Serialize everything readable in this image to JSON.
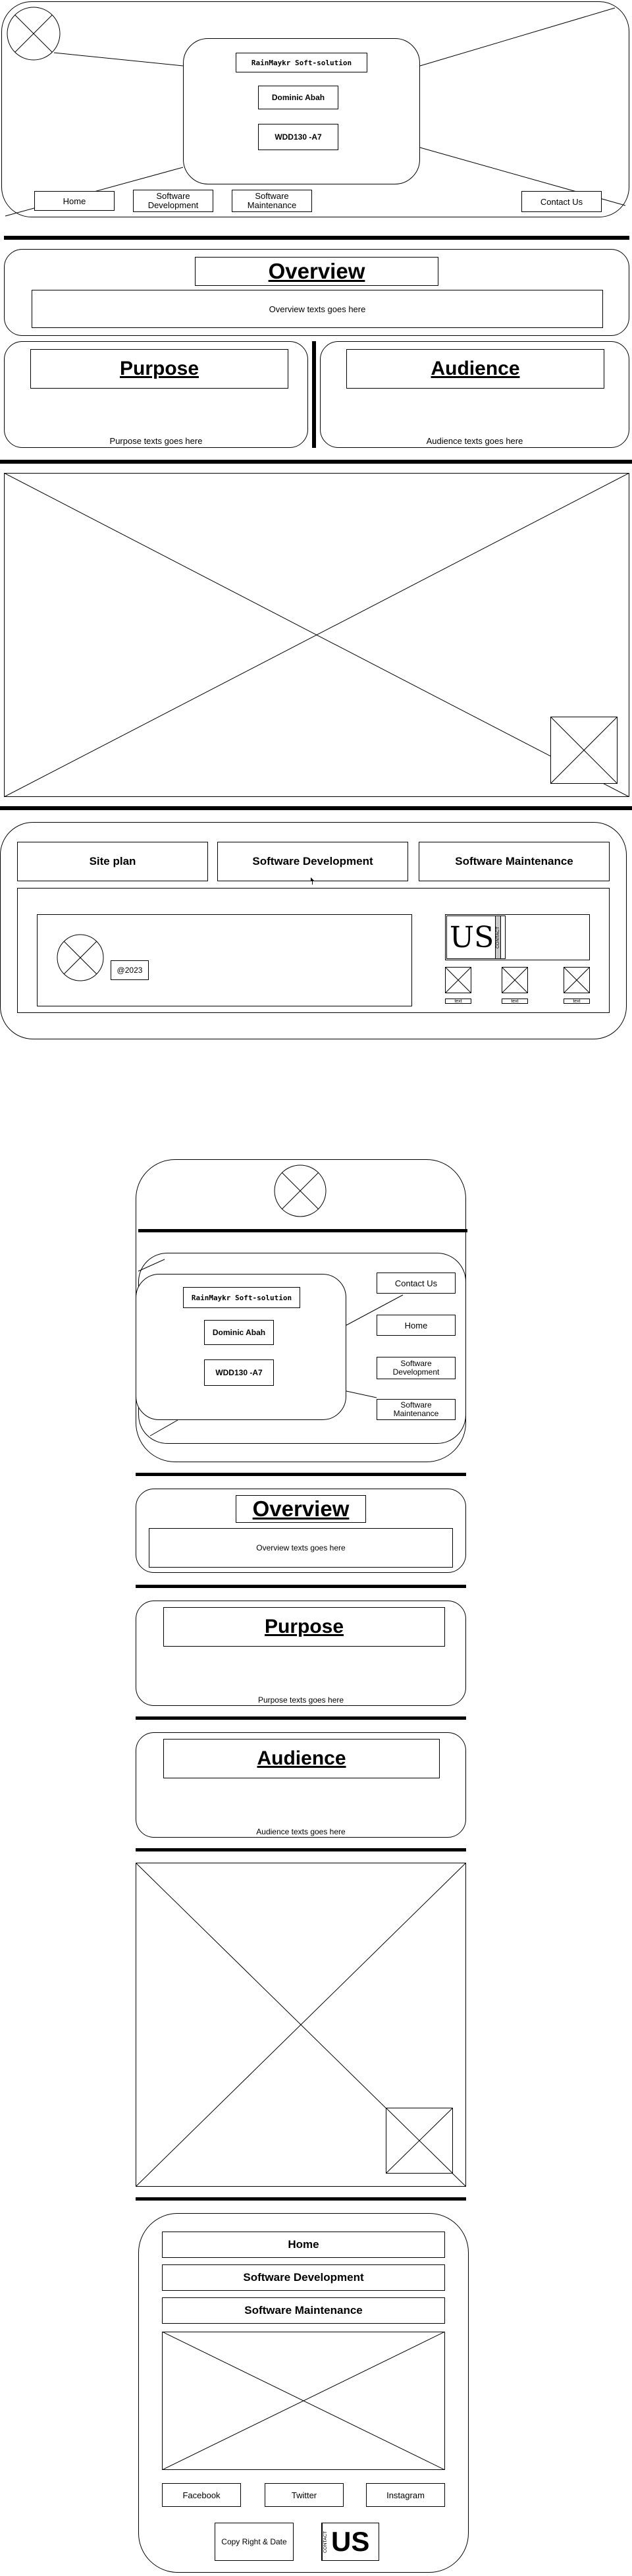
{
  "brand": {
    "name": "RainMaykr Soft-solution",
    "author": "Dominic Abah",
    "code": "WDD130 -A7"
  },
  "nav": {
    "home": "Home",
    "software_development": "Software Development",
    "software_maintenance": "Software Maintenance",
    "contact_us": "Contact Us"
  },
  "sections": {
    "overview_title": "Overview",
    "overview_text": "Overview texts goes here",
    "purpose_title": "Purpose",
    "purpose_text": "Purpose texts goes here",
    "audience_title": "Audience",
    "audience_text": "Audience texts goes here"
  },
  "siteplan": {
    "tabs": [
      "Site plan",
      "Software Development",
      "Software Maintenance"
    ],
    "copyright": "@2023",
    "contact_logo_letters": "US",
    "contact_logo_side": "CONTACT",
    "text_labels": [
      "text",
      "text",
      "text"
    ]
  },
  "mobile_footer": {
    "nav": [
      "Home",
      "Software Development",
      "Software Maintenance"
    ],
    "social": [
      "Facebook",
      "Twitter",
      "Instagram"
    ],
    "copyright": "Copy Right & Date",
    "contact_logo_letters": "US",
    "contact_logo_side": "CONTACT"
  }
}
